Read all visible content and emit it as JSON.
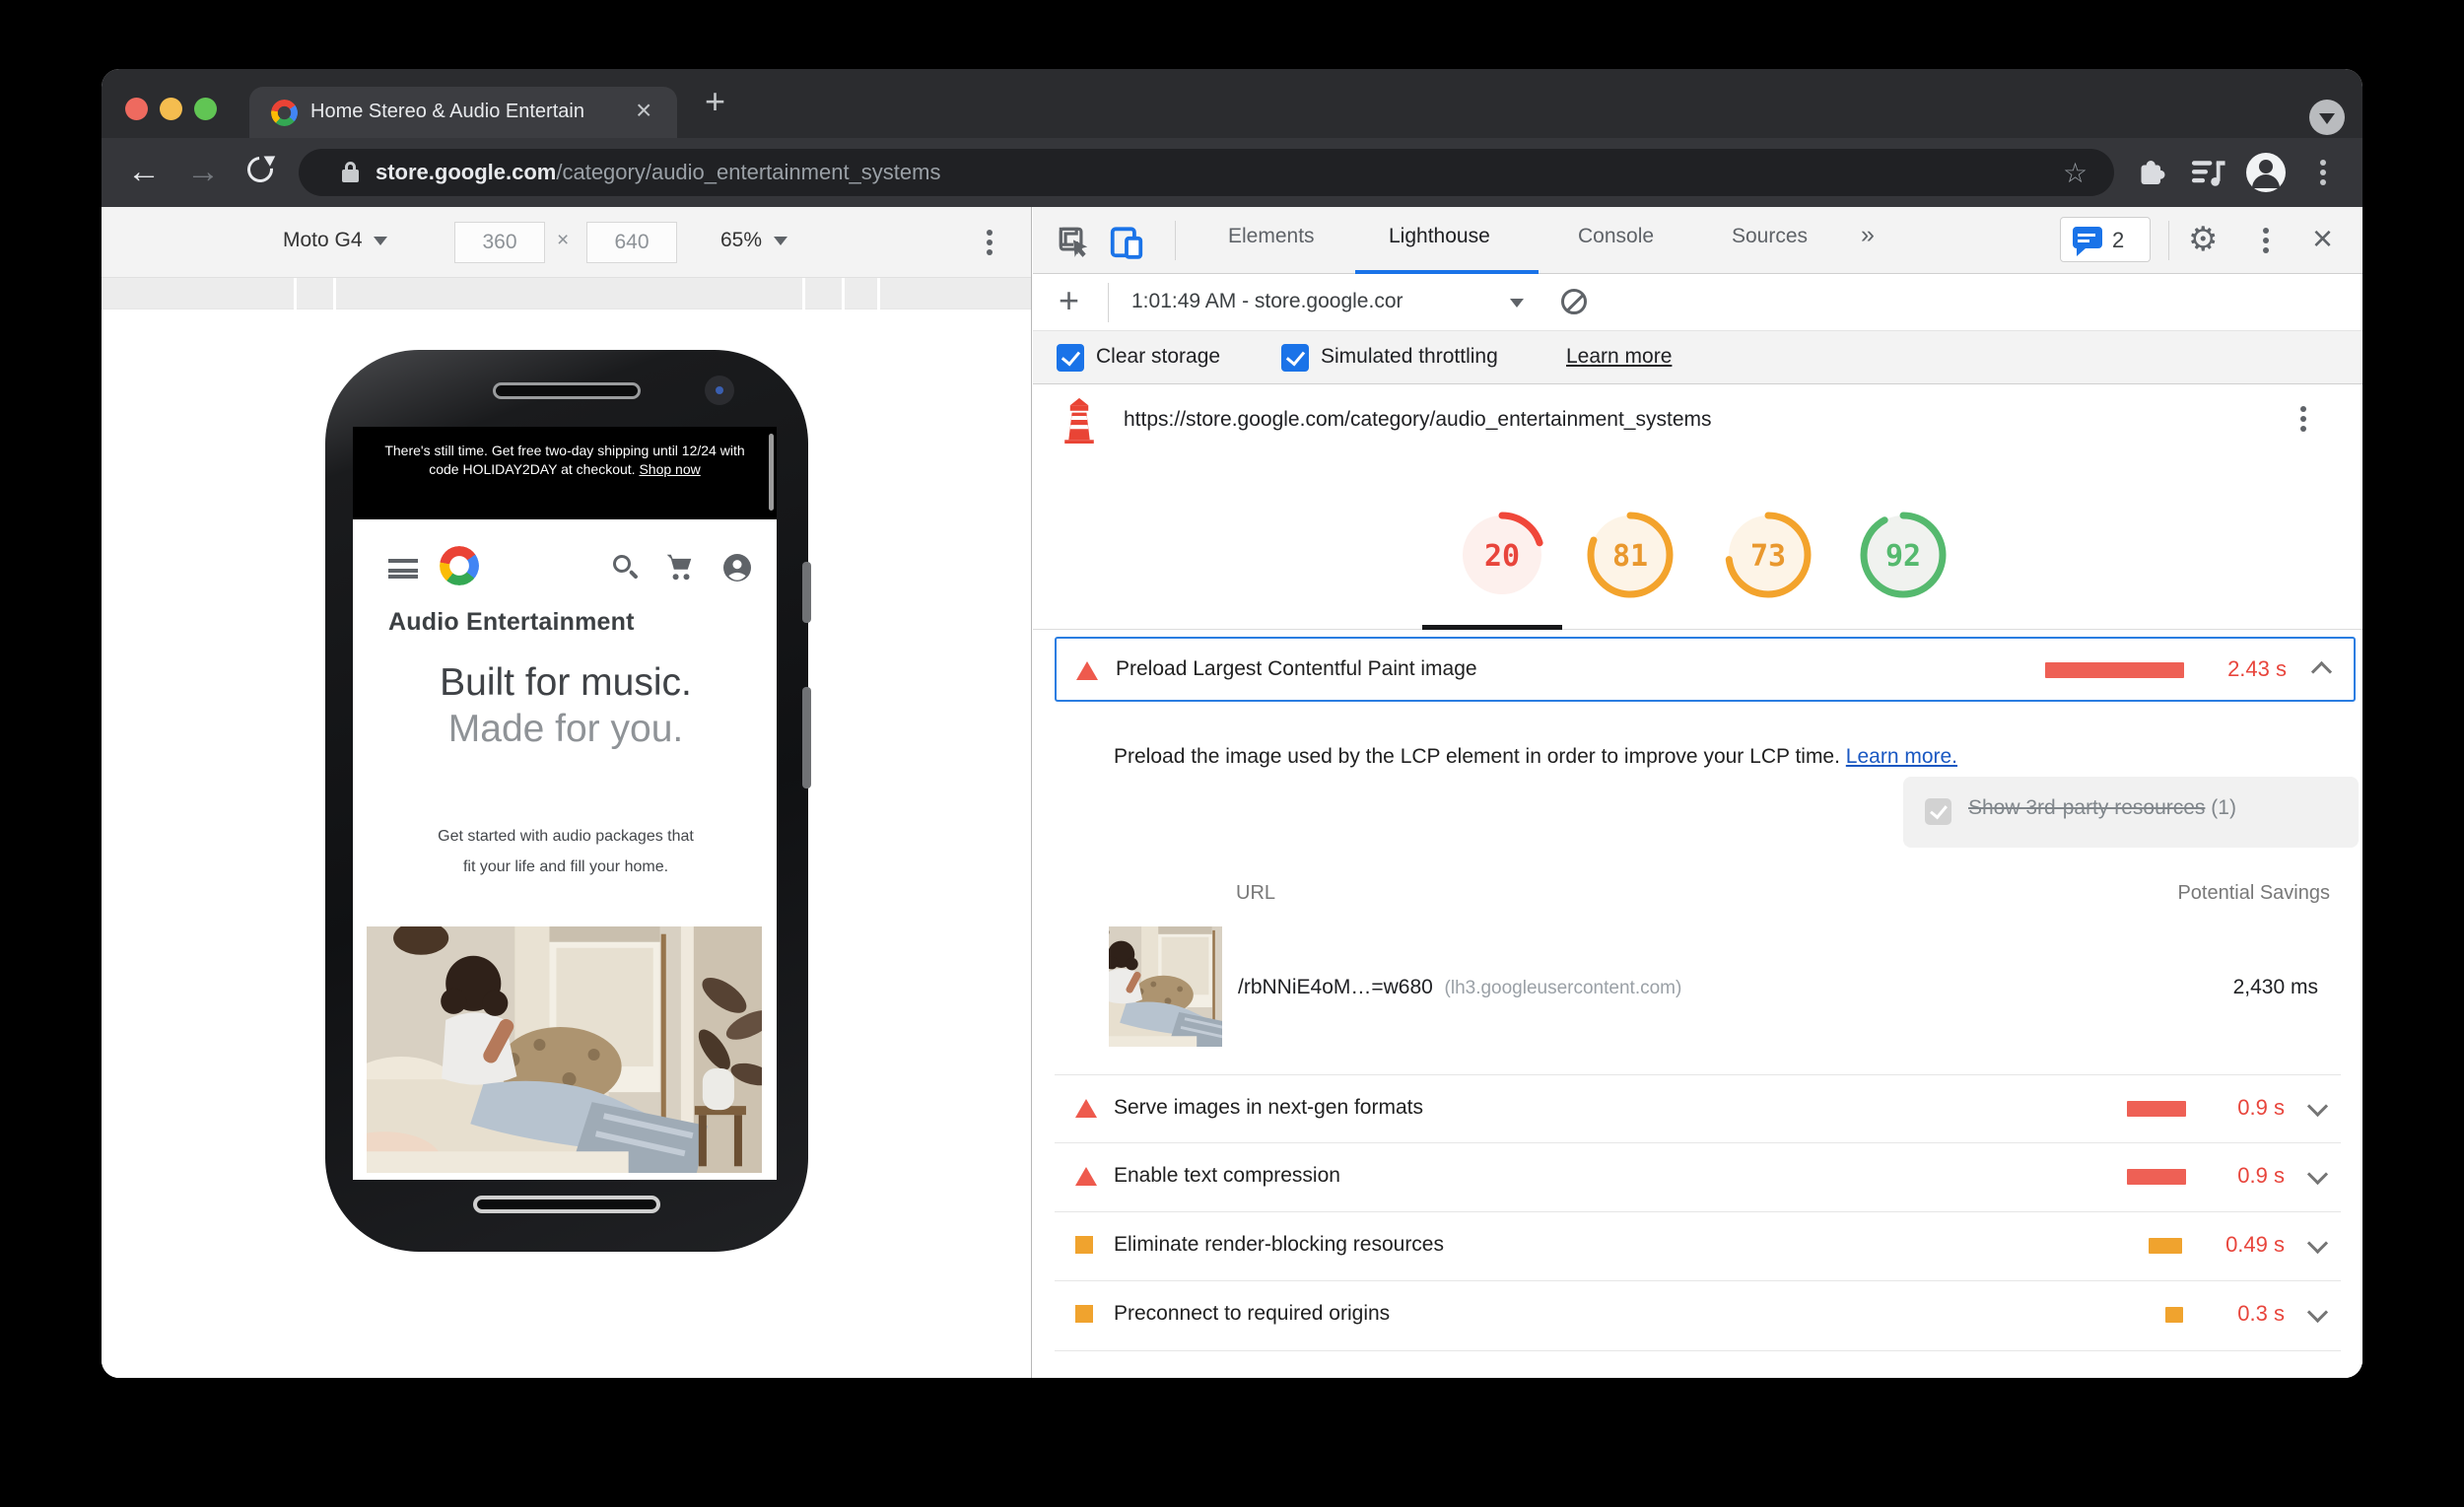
{
  "browser": {
    "tab_title": "Home Stereo & Audio Entertain",
    "tab_close": "×",
    "new_tab": "+",
    "back": "←",
    "forward": "→",
    "url_host": "store.google.com",
    "url_path": "/category/audio_entertainment_systems",
    "bookmark_star": "☆"
  },
  "device_toolbar": {
    "device": "Moto G4",
    "width": "360",
    "sep": "×",
    "height": "640",
    "zoom": "65%"
  },
  "devtools": {
    "tabs": {
      "elements": "Elements",
      "lighthouse": "Lighthouse",
      "console": "Console",
      "sources": "Sources"
    },
    "more_tabs": "»",
    "issues_count": "2",
    "gear": "⚙",
    "close": "×",
    "new_session": "+",
    "session_label": "1:01:49 AM - store.google.cor",
    "clear_storage_label": "Clear storage",
    "throttling_label": "Simulated throttling",
    "learn_more_label": "Learn more"
  },
  "lighthouse": {
    "url": "https://store.google.com/category/audio_entertainment_systems",
    "colors": {
      "fail": "#e8453c",
      "average": "#e9982e",
      "pass": "#55b96e",
      "bar_red": "#ee6055",
      "bar_orange": "#f0a32e",
      "focus_blue": "#2a7de1"
    },
    "scores": [
      {
        "value": "20",
        "status": "fail"
      },
      {
        "value": "81",
        "status": "average"
      },
      {
        "value": "73",
        "status": "average"
      },
      {
        "value": "92",
        "status": "pass"
      }
    ],
    "lcp": {
      "title": "Preload Largest Contentful Paint image",
      "value": "2.43 s",
      "description": "Preload the image used by the LCP element in order to improve your LCP time. ",
      "learn_more": "Learn more.",
      "third_party_label": "Show 3rd-party resources",
      "third_party_count": "(1)",
      "url_header": "URL",
      "savings_header": "Potential Savings",
      "row_url": "/rbNNiE4oM…=w680",
      "row_host": "(lh3.googleusercontent.com)",
      "row_savings": "2,430 ms"
    },
    "audits": [
      {
        "title": "Serve images in next-gen formats",
        "value": "0.9 s",
        "type": "fail"
      },
      {
        "title": "Enable text compression",
        "value": "0.9 s",
        "type": "fail"
      },
      {
        "title": "Eliminate render-blocking resources",
        "value": "0.49 s",
        "type": "average"
      },
      {
        "title": "Preconnect to required origins",
        "value": "0.3 s",
        "type": "average"
      }
    ]
  },
  "phone": {
    "banner_text": "There's still time. Get free two-day shipping until 12/24 with code HOLIDAY2DAY at checkout.  ",
    "banner_link": "Shop now",
    "heading": "Audio Entertainment",
    "hero_dark": "Built for music. ",
    "hero_light": "Made for you.",
    "subtext": "Get started with audio packages that fit your life and fill your home."
  }
}
